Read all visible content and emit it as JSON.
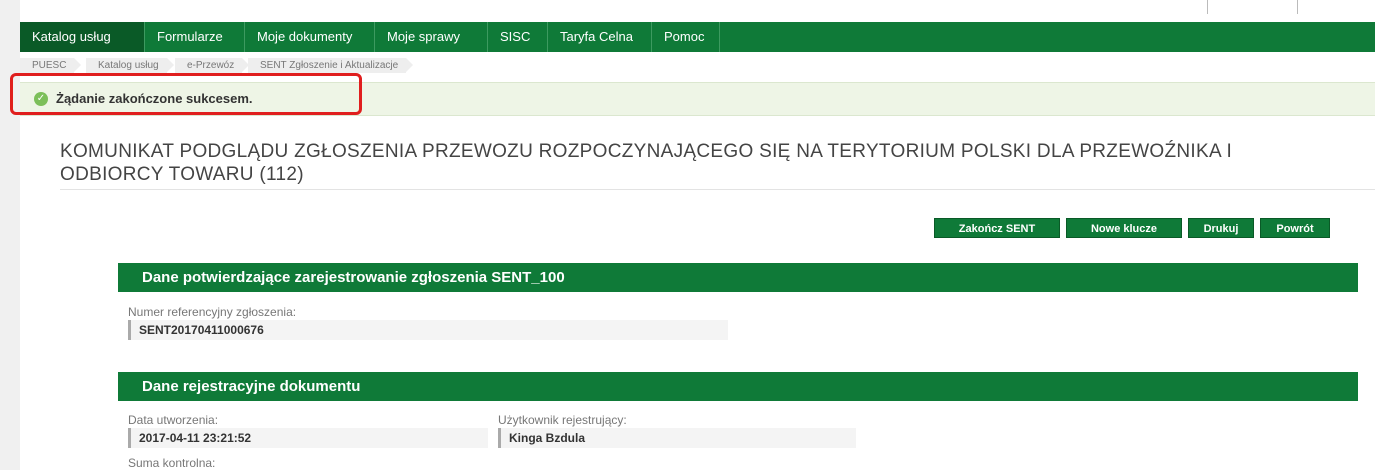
{
  "nav": {
    "items": [
      {
        "label": "Katalog usług",
        "active": true
      },
      {
        "label": "Formularze",
        "active": false
      },
      {
        "label": "Moje dokumenty",
        "active": false
      },
      {
        "label": "Moje sprawy",
        "active": false
      },
      {
        "label": "SISC",
        "active": false
      },
      {
        "label": "Taryfa Celna",
        "active": false
      },
      {
        "label": "Pomoc",
        "active": false
      }
    ]
  },
  "breadcrumb": {
    "items": [
      "PUESC",
      "Katalog usług",
      "e-Przewóz",
      "SENT Zgłoszenie i Aktualizacje"
    ]
  },
  "success": {
    "message": "Żądanie zakończone sukcesem."
  },
  "page_title": "KOMUNIKAT PODGLĄDU ZGŁOSZENIA PRZEWOZU ROZPOCZYNAJĄCEGO SIĘ NA TERYTORIUM POLSKI DLA PRZEWOŹNIKA I ODBIORCY TOWARU (112)",
  "actions": {
    "end_sent": "Zakończ SENT",
    "new_keys": "Nowe klucze",
    "print": "Drukuj",
    "back": "Powrót"
  },
  "section_confirm": {
    "title": "Dane potwierdzające zarejestrowanie zgłoszenia SENT_100",
    "ref_label": "Numer referencyjny zgłoszenia:",
    "ref_value": "SENT20170411000676"
  },
  "section_registration": {
    "title": "Dane rejestracyjne dokumentu",
    "created_label": "Data utworzenia:",
    "created_value": "2017-04-11 23:21:52",
    "user_label": "Użytkownik rejestrujący:",
    "user_value": "Kinga Bzdula",
    "checksum_label": "Suma kontrolna:"
  },
  "colors": {
    "brand_green": "#0f7a38",
    "highlight_red": "#e01e1e",
    "success_bg": "#eef5e6"
  }
}
